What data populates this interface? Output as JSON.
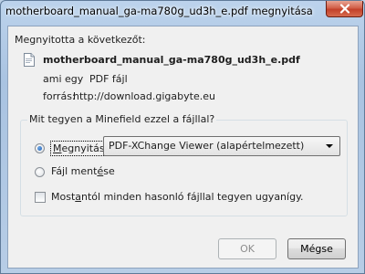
{
  "window": {
    "title": "motherboard_manual_ga-ma780g_ud3h_e.pdf megnyitása",
    "close_icon": "close-icon"
  },
  "dialog": {
    "prompt": "Megnyitotta a következőt:",
    "filename": "motherboard_manual_ga-ma780g_ud3h_e.pdf",
    "file_icon": "pdf-file-icon",
    "type_key": "ami egy",
    "type_value": "PDF fájl",
    "source_key": "forrás:",
    "source_value": "http://download.gigabyte.eu"
  },
  "action": {
    "legend": "Mit tegyen a Minefield ezzel a fájllal?",
    "open_label_access": "M",
    "open_label_rest": "egnyitás",
    "open_selected": true,
    "app_select_value": "PDF-XChange Viewer (alapértelmezett)",
    "save_label_pre": "Fájl ment",
    "save_label_access": "é",
    "save_label_post": "se",
    "save_selected": false,
    "always_label_pre": "Most",
    "always_label_access": "a",
    "always_label_post": "ntól minden hasonló fájllal tegyen ugyanígy.",
    "always_checked": false
  },
  "buttons": {
    "ok_label": "OK",
    "ok_enabled": false,
    "cancel_label": "Mégse"
  }
}
